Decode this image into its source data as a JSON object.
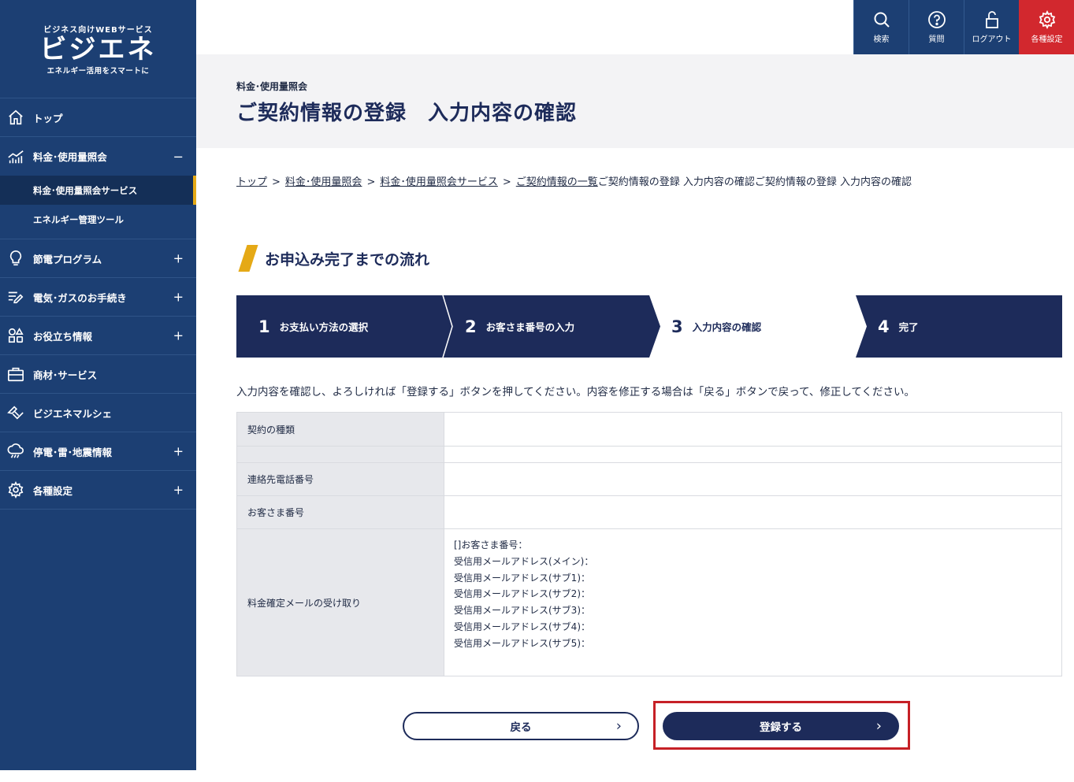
{
  "logo": {
    "tagline_top": "ビジネス向けWEBサービス",
    "name": "ビジエネ",
    "tagline_bottom": "エネルギー活用をスマートに"
  },
  "sidebar": {
    "items": [
      {
        "label": "トップ",
        "icon": "home-icon",
        "toggle": ""
      },
      {
        "label": "料金･使用量照会",
        "icon": "chart-icon",
        "toggle": "−"
      },
      {
        "label": "節電プログラム",
        "icon": "lightbulb-icon",
        "toggle": "+"
      },
      {
        "label": "電気･ガスのお手続き",
        "icon": "list-edit-icon",
        "toggle": "+"
      },
      {
        "label": "お役立ち情報",
        "icon": "grid-icon",
        "toggle": "+"
      },
      {
        "label": "商材･サービス",
        "icon": "bag-icon",
        "toggle": ""
      },
      {
        "label": "ビジエネマルシェ",
        "icon": "handshake-icon",
        "toggle": ""
      },
      {
        "label": "停電･雷･地震情報",
        "icon": "storm-icon",
        "toggle": "+"
      },
      {
        "label": "各種設定",
        "icon": "gear-icon",
        "toggle": "+"
      }
    ],
    "subitems": [
      {
        "label": "料金･使用量照会サービス"
      },
      {
        "label": "エネルギー管理ツール"
      }
    ]
  },
  "topbar": {
    "search": "検索",
    "faq": "質問",
    "logout": "ログアウト",
    "settings": "各種設定"
  },
  "page": {
    "category": "料金･使用量照会",
    "title": "ご契約情報の登録　入力内容の確認"
  },
  "breadcrumb": {
    "items": [
      "トップ",
      "料金･使用量照会",
      "料金･使用量照会サービス",
      "ご契約情報の一覧"
    ],
    "current": "ご契約情報の登録 入力内容の確認ご契約情報の登録 入力内容の確認",
    "separator": ">"
  },
  "flow": {
    "heading": "お申込み完了までの流れ",
    "steps": [
      {
        "num": "1",
        "label": "お支払い方法の選択"
      },
      {
        "num": "2",
        "label": "お客さま番号の入力"
      },
      {
        "num": "3",
        "label": "入力内容の確認"
      },
      {
        "num": "4",
        "label": "完了"
      }
    ],
    "active_step": 3,
    "colors": {
      "navy": "#1d2b5a",
      "accent": "#e5a916"
    }
  },
  "instruction": "入力内容を確認し、よろしければ「登録する」ボタンを押してください。内容を修正する場合は「戻る」ボタンで戻って、修正してください。",
  "table": {
    "rows": [
      {
        "label": "契約の種類",
        "value": ""
      },
      {
        "label": "",
        "value": ""
      },
      {
        "label": "連絡先電話番号",
        "value": ""
      },
      {
        "label": "お客さま番号",
        "value": ""
      }
    ],
    "mail": {
      "label": "料金確定メールの受け取り",
      "lines": [
        "[]お客さま番号：",
        "受信用メールアドレス(メイン)：",
        "受信用メールアドレス(サブ1)：",
        "受信用メールアドレス(サブ2)：",
        "受信用メールアドレス(サブ3)：",
        "受信用メールアドレス(サブ4)：",
        "受信用メールアドレス(サブ5)："
      ]
    }
  },
  "buttons": {
    "back": "戻る",
    "submit": "登録する"
  }
}
